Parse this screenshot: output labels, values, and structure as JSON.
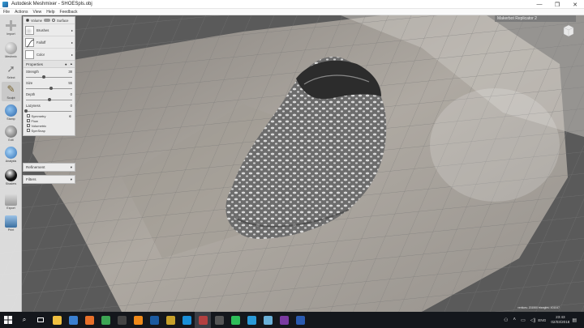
{
  "window": {
    "title": "Autodesk Meshmixer - SHOESpls.obj",
    "controls": [
      "—",
      "❐",
      "✕"
    ]
  },
  "menu": [
    "File",
    "Actions",
    "View",
    "Help",
    "Feedback"
  ],
  "tools": [
    {
      "label": "Import",
      "color": "#cfcfcf"
    },
    {
      "label": "Meshmix",
      "color": "#a8a8a8"
    },
    {
      "label": "Select",
      "color": "#d7d7d7"
    },
    {
      "label": "Sculpt",
      "color": "#bfa66a"
    },
    {
      "label": "Stamp",
      "color": "#3b7ec9"
    },
    {
      "label": "Edit",
      "color": "#8a8a8a"
    },
    {
      "label": "Analysis",
      "color": "#4a8fd4"
    },
    {
      "label": "Shaders",
      "color": "#202020"
    },
    {
      "label": "Export",
      "color": "#bcbcbc"
    },
    {
      "label": "Print",
      "color": "#4e7fb0"
    }
  ],
  "panel": {
    "mode_volume": "Volume",
    "mode_surface": "Surface",
    "brushes_label": "Brushes",
    "falloff_label": "Falloff",
    "color_label": "Color",
    "properties_title": "Properties",
    "sliders": [
      {
        "label": "Strength",
        "value": "38",
        "fraction": 0.38
      },
      {
        "label": "Size",
        "value": "55",
        "fraction": 0.55
      },
      {
        "label": "Depth",
        "value": "0",
        "fraction": 0.5
      },
      {
        "label": "Lazyness",
        "value": "0",
        "fraction": 0.0
      }
    ],
    "checks": [
      {
        "label": "Symmetry",
        "checked": false
      },
      {
        "label": "Flow",
        "checked": true
      },
      {
        "label": "Volumetric",
        "checked": true
      },
      {
        "label": "SymSnap",
        "checked": false
      }
    ],
    "refinement_title": "Refinement",
    "filters_title": "Filters"
  },
  "printer": "Makerbot Replicator 2",
  "stats": "vertices: 201900 triangles: 401047",
  "taskbar": {
    "apps": [
      {
        "name": "file-explorer",
        "color": "#f0c040"
      },
      {
        "name": "store",
        "color": "#3a7fd0"
      },
      {
        "name": "firefox",
        "color": "#e8702a"
      },
      {
        "name": "chrome",
        "color": "#3ca553"
      },
      {
        "name": "media",
        "color": "#444"
      },
      {
        "name": "vlc",
        "color": "#f08a1a"
      },
      {
        "name": "photoshop",
        "color": "#1b5aa0"
      },
      {
        "name": "illustrator",
        "color": "#c7a02a"
      },
      {
        "name": "cura",
        "color": "#1a8fd8"
      },
      {
        "name": "meshmixer",
        "color": "#b24040"
      },
      {
        "name": "calculator",
        "color": "#555"
      },
      {
        "name": "whatsapp",
        "color": "#2dbd58"
      },
      {
        "name": "telegram",
        "color": "#2a9ad8"
      },
      {
        "name": "notes",
        "color": "#6ab0d8"
      },
      {
        "name": "onenote",
        "color": "#7a3aa0"
      },
      {
        "name": "revit",
        "color": "#2a5ab0"
      }
    ],
    "lang": "ENG",
    "time": "23:43",
    "date": "02/03/2018"
  }
}
